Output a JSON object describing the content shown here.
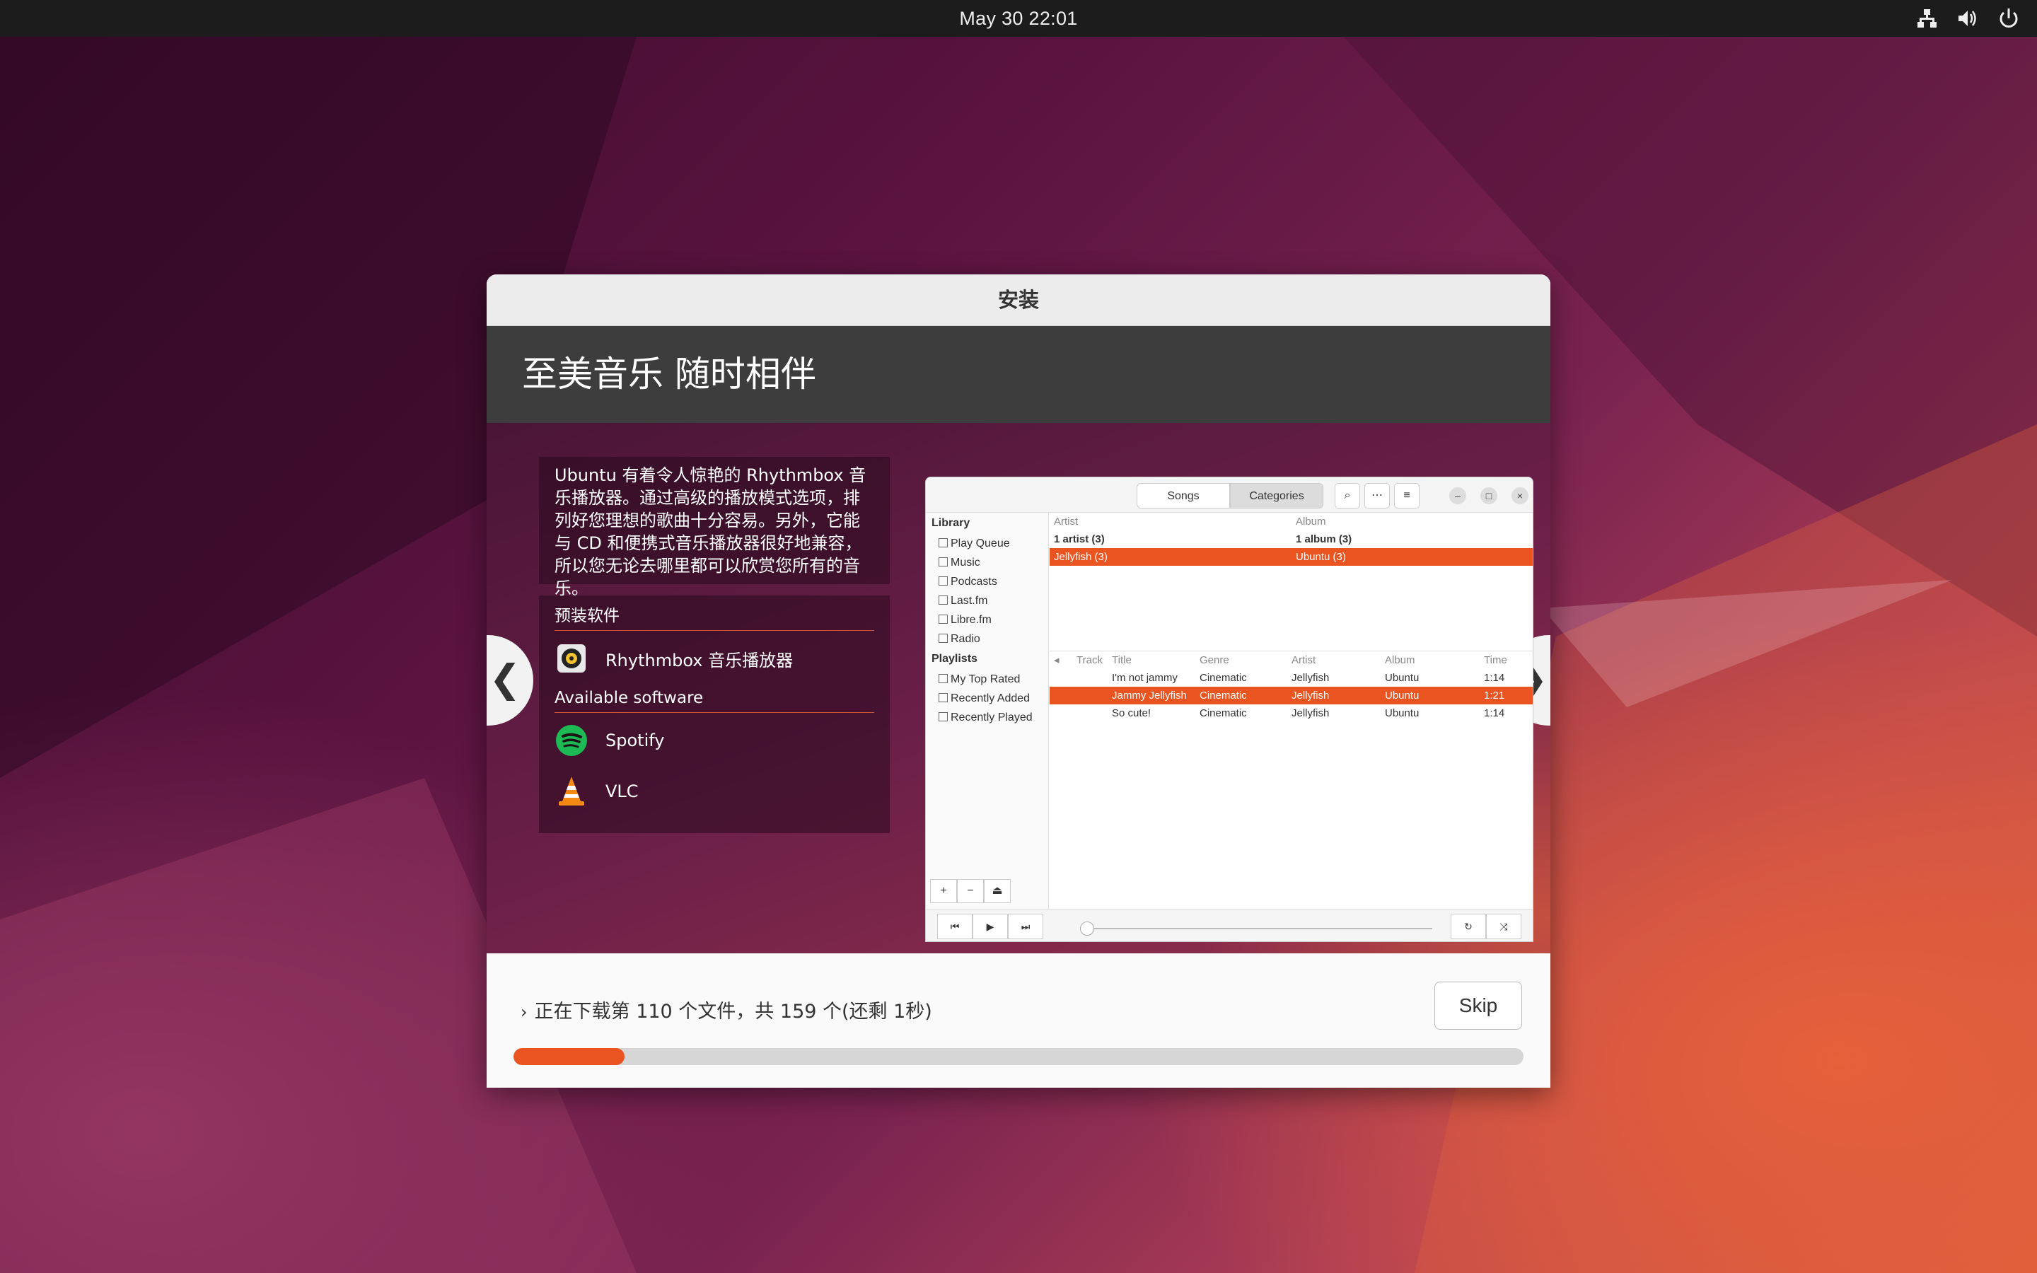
{
  "topbar": {
    "clock": "May 30  22:01",
    "tray_icons": [
      "network-icon",
      "volume-icon",
      "power-icon"
    ]
  },
  "window": {
    "title": "安装"
  },
  "slide": {
    "header": "至美音乐 随时相伴",
    "description": "Ubuntu 有着令人惊艳的 Rhythmbox 音乐播放器。通过高级的播放模式选项，排列好您理想的歌曲十分容易。另外，它能与 CD 和便携式音乐播放器很好地兼容，所以您无论去哪里都可以欣赏您所有的音乐。",
    "preinstalled_heading": "预装软件",
    "preinstalled": [
      {
        "label": "Rhythmbox 音乐播放器",
        "icon": "rhythmbox-icon"
      }
    ],
    "available_heading": "Available software",
    "available": [
      {
        "label": "Spotify",
        "icon": "spotify-icon"
      },
      {
        "label": "VLC",
        "icon": "vlc-icon"
      }
    ],
    "prev_arrow": "❮",
    "next_arrow": "❯"
  },
  "rhythmbox": {
    "tabs": [
      "Songs",
      "Categories"
    ],
    "active_tab": "Categories",
    "sidebar": {
      "library_label": "Library",
      "library": [
        "Play Queue",
        "Music",
        "Podcasts",
        "Last.fm",
        "Libre.fm",
        "Radio"
      ],
      "playlists_label": "Playlists",
      "playlists": [
        "My Top Rated",
        "Recently Added",
        "Recently Played"
      ]
    },
    "browser": {
      "artist_header": "Artist",
      "album_header": "Album",
      "artist_all": "1 artist (3)",
      "album_all": "1 album (3)",
      "artist_sel": "Jellyfish (3)",
      "album_sel": "Ubuntu (3)"
    },
    "track_headers": [
      "Track",
      "Title",
      "Genre",
      "Artist",
      "Album",
      "Time"
    ],
    "tracks": [
      {
        "title": "I'm not jammy",
        "genre": "Cinematic",
        "artist": "Jellyfish",
        "album": "Ubuntu",
        "time": "1:14"
      },
      {
        "title": "Jammy Jellyfish",
        "genre": "Cinematic",
        "artist": "Jellyfish",
        "album": "Ubuntu",
        "time": "1:21"
      },
      {
        "title": "So cute!",
        "genre": "Cinematic",
        "artist": "Jellyfish",
        "album": "Ubuntu",
        "time": "1:14"
      }
    ],
    "selected_track_index": 1
  },
  "footer": {
    "status": "正在下载第 110 个文件，共 159 个(还剩 1秒)",
    "skip_label": "Skip",
    "progress": 0.11
  },
  "colors": {
    "accent": "#e95420",
    "topbar": "#1c1c1c",
    "slide_header": "#3d3d3d"
  }
}
